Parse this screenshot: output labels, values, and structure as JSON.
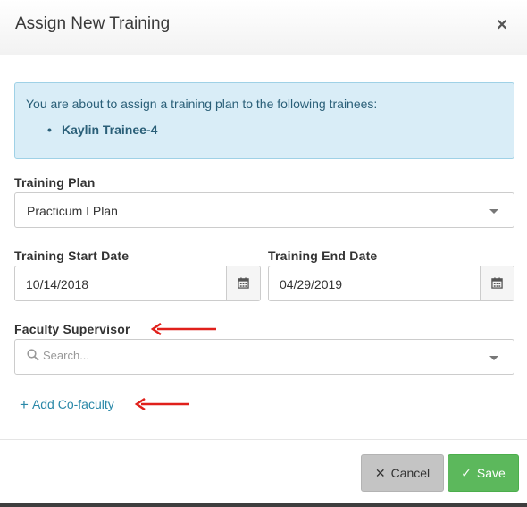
{
  "modal": {
    "title": "Assign New Training",
    "close_glyph": "×"
  },
  "info": {
    "message": "You are about to assign a training plan to the following trainees:",
    "trainees": [
      "Kaylin Trainee-4"
    ]
  },
  "form": {
    "training_plan": {
      "label": "Training Plan",
      "value": "Practicum I Plan"
    },
    "start_date": {
      "label": "Training Start Date",
      "value": "10/14/2018",
      "icon": "calendar-icon"
    },
    "end_date": {
      "label": "Training End Date",
      "value": "04/29/2019",
      "icon": "calendar-icon"
    },
    "faculty_supervisor": {
      "label": "Faculty Supervisor",
      "placeholder": "Search...",
      "icon": "search-icon"
    },
    "add_cofaculty": {
      "label": "Add Co-faculty",
      "glyph": "+"
    }
  },
  "footer": {
    "cancel_label": "Cancel",
    "cancel_glyph": "✕",
    "save_label": "Save",
    "save_glyph": "✓"
  },
  "colors": {
    "info_bg": "#d9edf7",
    "info_text": "#2a5f78",
    "link": "#2a88a8",
    "save_bg": "#5cb85c",
    "cancel_bg": "#c4c4c4",
    "annotation_arrow": "#e0201b"
  },
  "annotations": [
    {
      "name": "arrow-faculty-supervisor",
      "icon": "red-arrow-icon"
    },
    {
      "name": "arrow-add-cofaculty",
      "icon": "red-arrow-icon"
    }
  ]
}
